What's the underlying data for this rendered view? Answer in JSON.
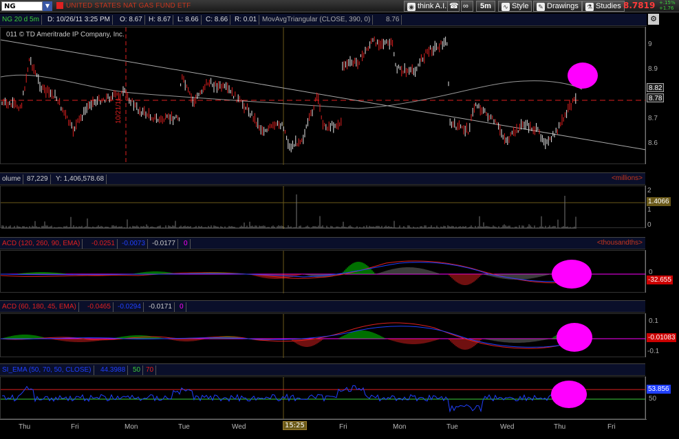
{
  "toolbar": {
    "symbol": "NG",
    "description": "UNITED STATES NAT GAS FUND ETF",
    "think_ai": "think A.I.",
    "timeframe": "5m",
    "style": "Style",
    "drawings": "Drawings",
    "studies": "Studies",
    "last": "8.7819",
    "net_change_pct": "+.15%",
    "net_change": "+1.76"
  },
  "info_bar": {
    "aggregation": "NG 20 d 5m",
    "date": "D: 10/26/11 3:25 PM",
    "open": "O: 8.67",
    "high": "H: 8.67",
    "low": "L: 8.66",
    "close": "C: 8.66",
    "range": "R: 0.01",
    "study": "MovAvgTriangular (CLOSE, 390, 0)",
    "study_value": "8.76"
  },
  "price_pane": {
    "copyright": "011 © TD Ameritrade IP Company, Inc.",
    "vertical_label": "10/21/11",
    "axis_labels": [
      "9",
      "8.9",
      "8.7",
      "8.6"
    ],
    "tag_upper": "8.82",
    "tag_lower": "8.78"
  },
  "volume_pane": {
    "title": "olume",
    "value": "87,229",
    "y": "Y: 1,406,578.68",
    "unit": "<millions>",
    "axis_labels": [
      "2",
      "1",
      "0"
    ],
    "tag": "1.4066"
  },
  "macd1": {
    "title": "ACD (120, 260, 90, EMA)",
    "value": "-0.0251",
    "avg": "-0.0073",
    "diff": "-0.0177",
    "zero": "0",
    "unit": "<thousandths>",
    "axis_labels": [
      "0"
    ],
    "tag": "-32.655"
  },
  "macd2": {
    "title": "ACD (60, 180, 45, EMA)",
    "value": "-0.0465",
    "avg": "-0.0294",
    "diff": "-0.0171",
    "zero": "0",
    "axis_labels": [
      "0.1",
      "-0.1"
    ],
    "tag": "-0.01083"
  },
  "rsi": {
    "title": "SI_EMA (50, 70, 50, CLOSE)",
    "value": "44.3988",
    "ob": "50",
    "os": "70",
    "axis_labels": [
      "50"
    ],
    "tag": "53.856"
  },
  "time_axis": {
    "labels": [
      "Thu",
      "Fri",
      "Mon",
      "Tue",
      "Wed",
      "Fri",
      "Mon",
      "Tue",
      "Wed",
      "Thu",
      "Fri"
    ],
    "cursor": "15:25"
  },
  "colors": {
    "up": "#e8e8e8",
    "down": "#e02020",
    "accent": "#ff00ff",
    "signal_blue": "#2040ff",
    "hist_green": "#00e000"
  }
}
